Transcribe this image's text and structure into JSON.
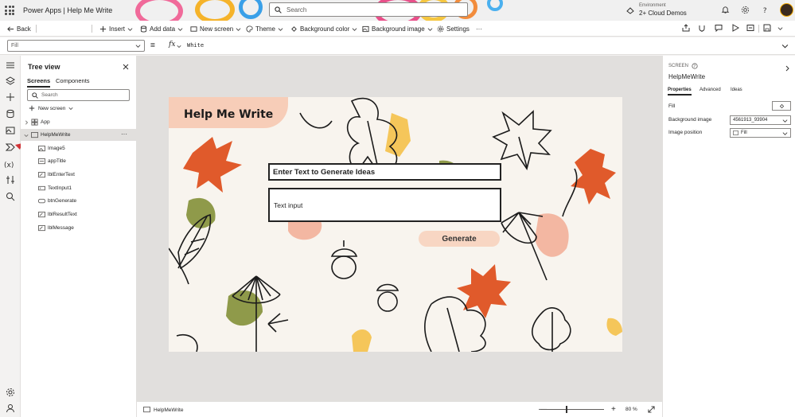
{
  "titlebar": {
    "app_title": "Power Apps  |  Help Me Write",
    "search_placeholder": "Search",
    "environment_label": "Environment",
    "environment_name": "2+ Cloud Demos"
  },
  "commandbar": {
    "back": "Back",
    "insert": "Insert",
    "add_data": "Add data",
    "new_screen": "New screen",
    "theme": "Theme",
    "background_color": "Background color",
    "background_image": "Background image",
    "settings": "Settings",
    "more": "···"
  },
  "formulabar": {
    "property": "Fill",
    "equals": "=",
    "fx": "fx",
    "value": "White"
  },
  "tree": {
    "title": "Tree view",
    "tabs": [
      "Screens",
      "Components"
    ],
    "search_placeholder": "Search",
    "new_screen": "New screen",
    "items": [
      {
        "label": "App"
      },
      {
        "label": "HelpMeWrite"
      },
      {
        "label": "Image5"
      },
      {
        "label": "appTitle"
      },
      {
        "label": "lblEnterText"
      },
      {
        "label": "TextInput1"
      },
      {
        "label": "btnGenerate"
      },
      {
        "label": "lblResultText"
      },
      {
        "label": "lblMessage"
      }
    ]
  },
  "canvas": {
    "title": "Help Me Write",
    "enter_label": "Enter Text to Generate Ideas",
    "input_placeholder": "Text input",
    "generate_button": "Generate"
  },
  "statusbar": {
    "screen_name": "HelpMeWrite",
    "zoom_minus": "—",
    "zoom_plus": "+",
    "zoom_value": "80  %"
  },
  "properties": {
    "kind": "SCREEN",
    "name": "HelpMeWrite",
    "tabs": [
      "Properties",
      "Advanced",
      "Ideas"
    ],
    "fill_label": "Fill",
    "background_image_label": "Background image",
    "background_image_value": "4561913_93904",
    "image_position_label": "Image position",
    "image_position_value": "Fill"
  },
  "colors": {
    "accent_red": "#d13438",
    "leaf_orange": "#e05a2b",
    "leaf_olive": "#8f9a4a",
    "leaf_yellow": "#f5c65a",
    "peach": "#f7cdb8"
  }
}
